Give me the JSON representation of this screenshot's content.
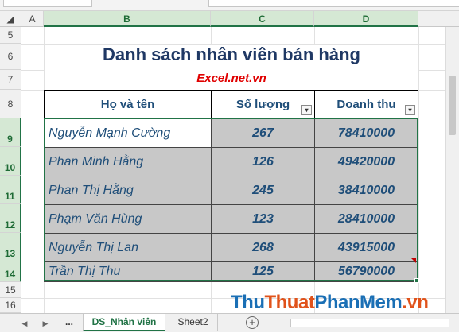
{
  "columns": [
    "A",
    "B",
    "C",
    "D"
  ],
  "rows": [
    "5",
    "6",
    "7",
    "8",
    "9",
    "10",
    "11",
    "12",
    "13",
    "14",
    "15",
    "16"
  ],
  "sheet": {
    "title": "Danh sách nhân viên bán hàng",
    "subtitle": "Excel.net.vn"
  },
  "table": {
    "headers": [
      "Họ và tên",
      "Số lượng",
      "Doanh thu"
    ],
    "rows": [
      {
        "name": "Nguyễn  Mạnh Cường",
        "qty": "267",
        "revenue": "78410000"
      },
      {
        "name": "Phan  Minh Hằng",
        "qty": "126",
        "revenue": "49420000"
      },
      {
        "name": "Phan  Thị Hằng",
        "qty": "245",
        "revenue": "38410000"
      },
      {
        "name": "Phạm  Văn Hùng",
        "qty": "123",
        "revenue": "28410000"
      },
      {
        "name": "Nguyễn  Thị Lan",
        "qty": "268",
        "revenue": "43915000"
      },
      {
        "name": "Trần  Thị Thu",
        "qty": "125",
        "revenue": "56790000"
      }
    ]
  },
  "tabs": {
    "ellipsis": "...",
    "active": "DS_Nhân viên",
    "other": "Sheet2",
    "add": "+"
  },
  "watermark": {
    "part1": "Thu",
    "part2": "Thuat",
    "part3": "PhanMem",
    "part4": ".vn"
  },
  "colors": {
    "accent": "#217346",
    "title": "#1f3864",
    "text": "#1f4e79",
    "subtitle": "#e00000",
    "cell_fill": "#c8c8c8"
  }
}
